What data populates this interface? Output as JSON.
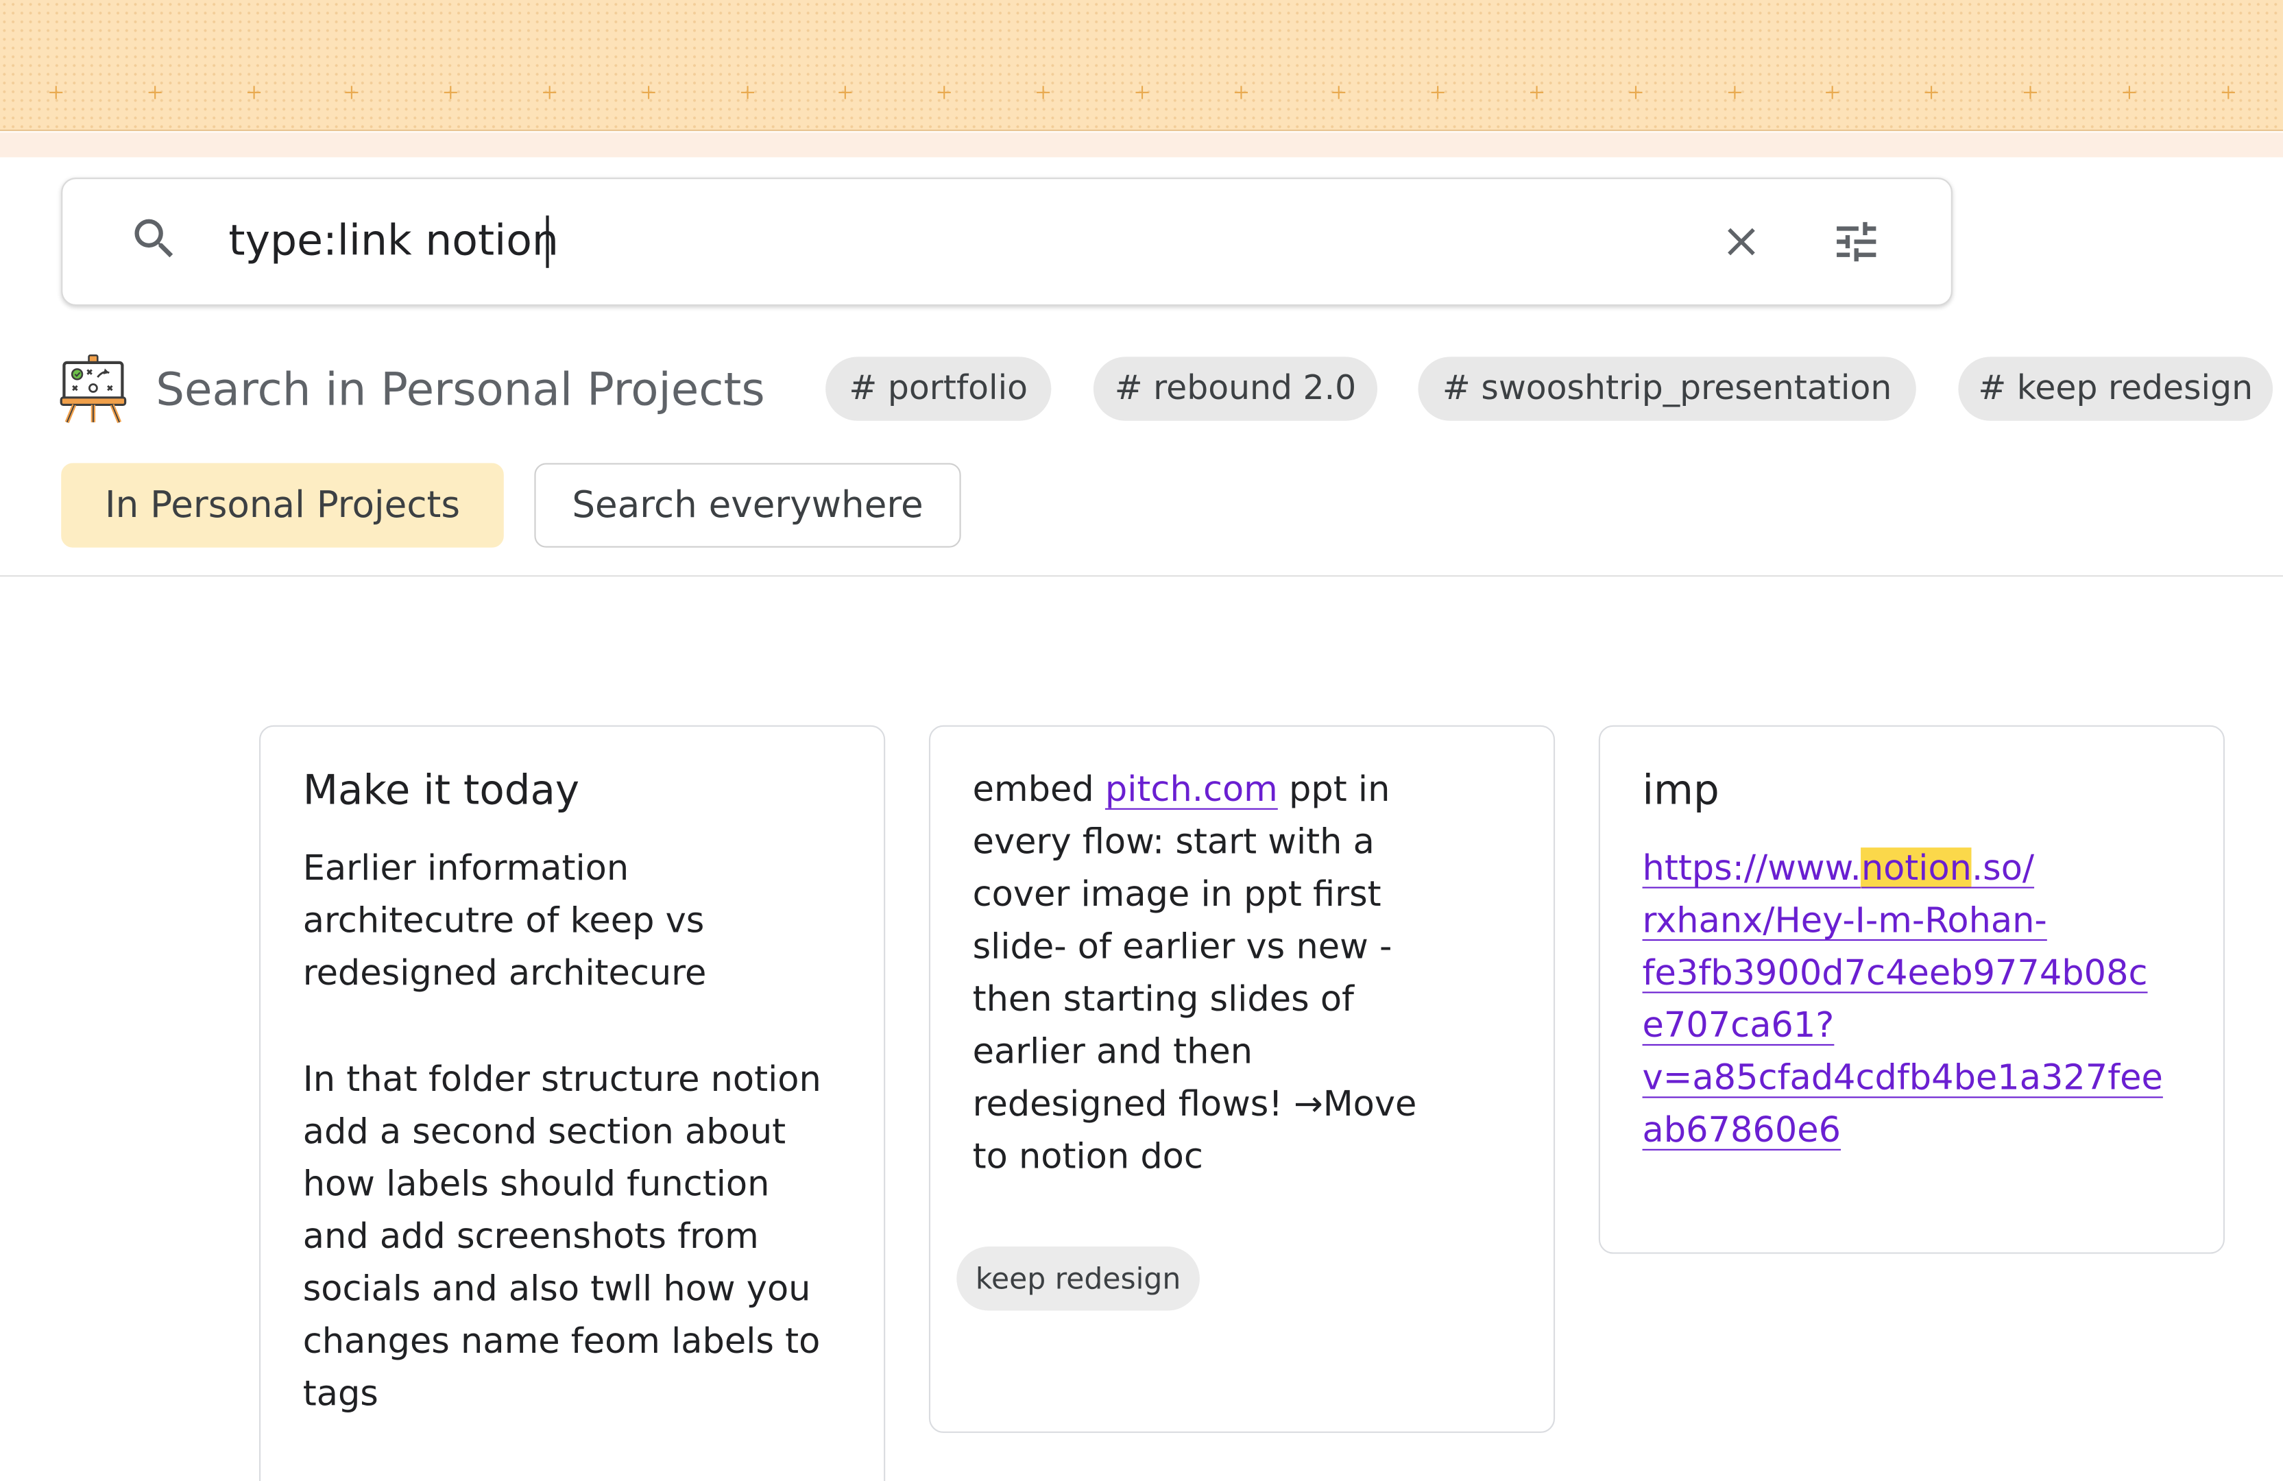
{
  "search": {
    "query": "type:link notion"
  },
  "scope": {
    "title": "Search in Personal Projects",
    "tags": [
      "# portfolio",
      "# rebound 2.0",
      "# swooshtrip_presentation",
      "# keep redesign"
    ],
    "in_scope_label": "In Personal Projects",
    "everywhere_label": "Search everywhere"
  },
  "notes": [
    {
      "title": "Make it today",
      "lines": [
        "Earlier information",
        "architecutre of keep vs",
        "redesigned architecure",
        "",
        "In that folder structure notion",
        "add a second section about",
        "how labels should function",
        "and add screenshots from",
        "socials and also twll how you",
        "changes name feom labels to",
        "tags"
      ]
    },
    {
      "line1_prefix": "embed ",
      "line1_link": "pitch.com",
      "line1_suffix": " ppt in",
      "lines": [
        "every flow: start with a",
        "cover image in ppt first",
        "slide- of earlier vs new -",
        "then starting slides of",
        "earlier and then",
        "redesigned flows! →Move",
        "to notion doc"
      ],
      "label": "keep redesign"
    },
    {
      "title": "imp",
      "url_prefix": "https://www.",
      "url_highlight": "notion",
      "url_suffix": ".so/",
      "url_lines": [
        "rxhanx/Hey-I-m-Rohan-",
        "fe3fb3900d7c4eeb9774b08c",
        "e707ca61?",
        "v=a85cfad4cdfb4be1a327fee",
        "ab67860e6"
      ]
    }
  ],
  "colors": {
    "banner": "#fde2b8",
    "active_scope": "#fdedc3",
    "link": "#6a1fd1",
    "highlight": "#fbd84a"
  },
  "icons": [
    "search-icon",
    "close-icon",
    "tune-icon",
    "whiteboard-icon"
  ]
}
